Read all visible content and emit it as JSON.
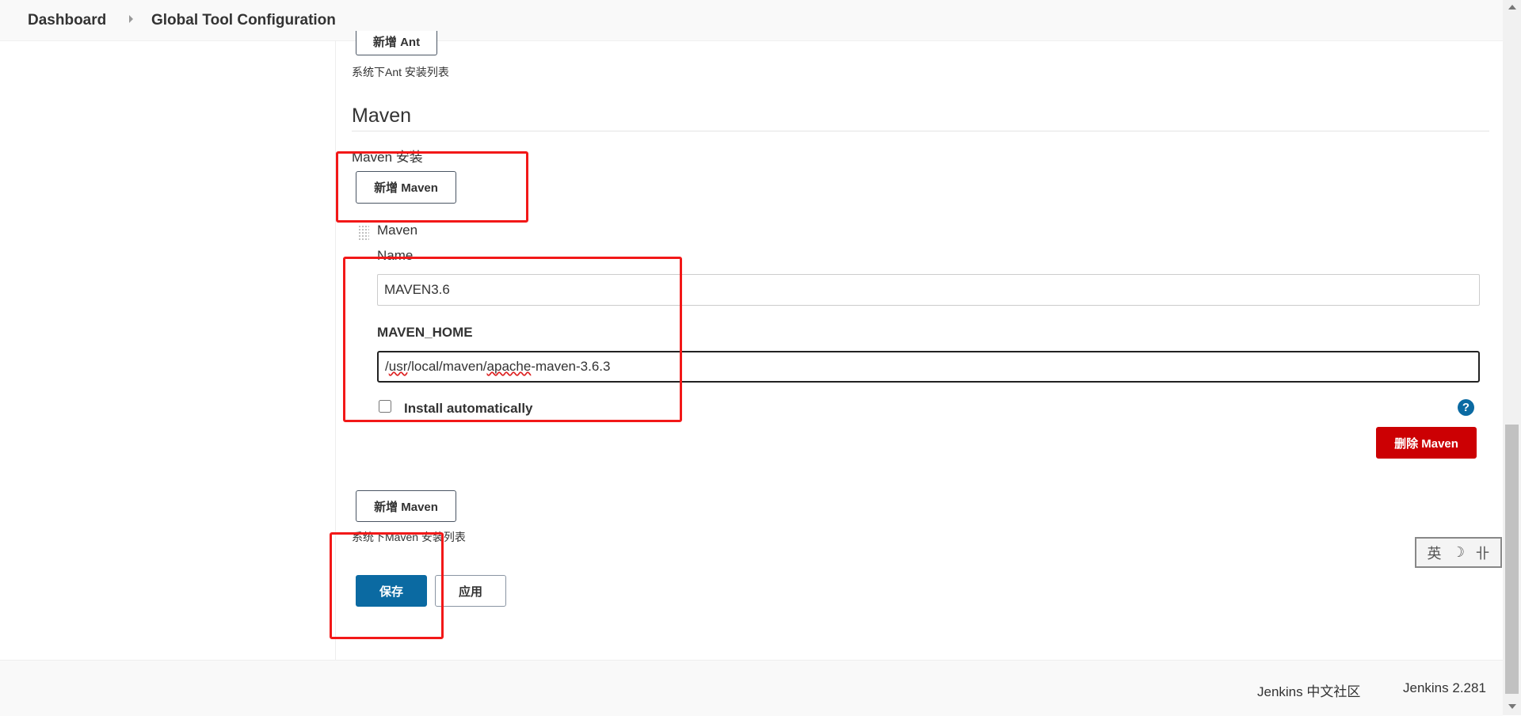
{
  "breadcrumb": {
    "home": "Dashboard",
    "current": "Global Tool Configuration"
  },
  "ant": {
    "add_button": "新增 Ant",
    "list_caption": "系统下Ant 安装列表"
  },
  "maven": {
    "section_title": "Maven",
    "installations_label": "Maven 安装",
    "add_button_top": "新增 Maven",
    "item_header": "Maven",
    "name_label": "Name",
    "name_value": "MAVEN3.6",
    "home_label": "MAVEN_HOME",
    "home_value": {
      "p1": "/",
      "p2": "usr",
      "p3": "/local/maven/",
      "p4": "apache",
      "p5": "-maven-3.6.3"
    },
    "install_auto_label": "Install automatically",
    "help_symbol": "?",
    "delete_button": "删除 Maven",
    "add_button_bottom": "新增 Maven",
    "list_caption": "系统下Maven 安装列表"
  },
  "actions": {
    "save": "保存",
    "apply": "应用"
  },
  "ime": {
    "char1": "英",
    "char2": "☽",
    "char3": "卝"
  },
  "footer": {
    "community": "Jenkins 中文社区",
    "version": "Jenkins 2.281"
  },
  "colors": {
    "primary": "#0b6aa2",
    "danger": "#cc0003",
    "annotation": "#f21818"
  }
}
